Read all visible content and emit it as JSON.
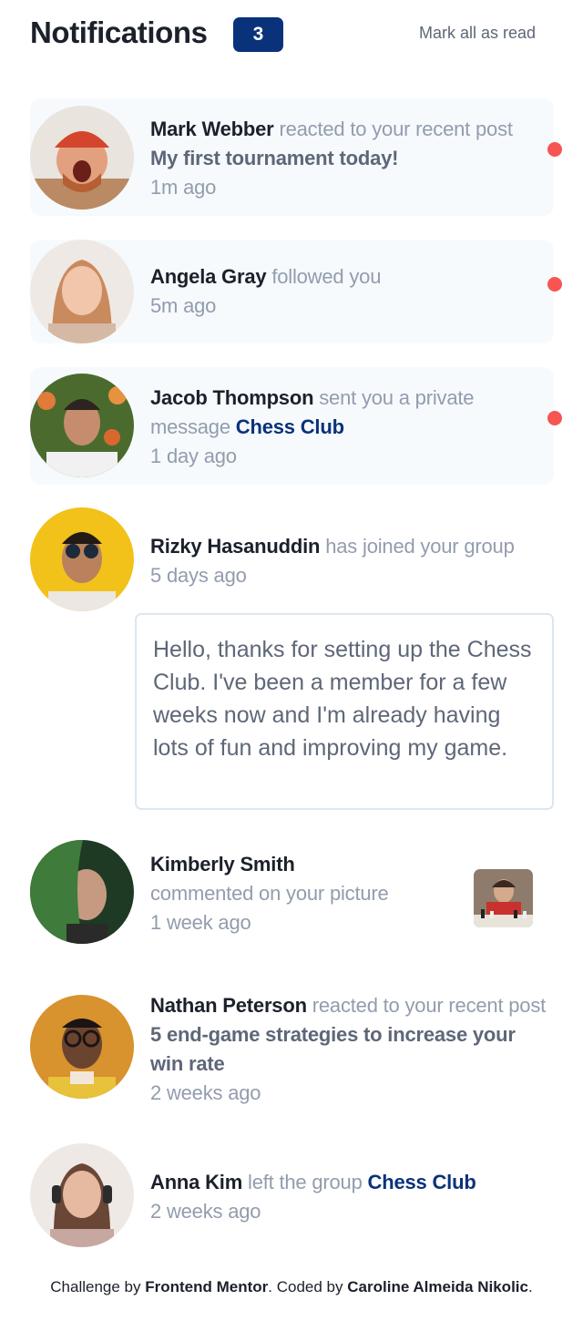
{
  "header": {
    "title": "Notifications",
    "unread_count": "3",
    "mark_all_label": "Mark all as read"
  },
  "colors": {
    "accent": "#0a327b",
    "unread_dot": "#f65552",
    "unread_bg": "#f6fafd",
    "muted_text": "#939cad",
    "dark_text": "#1c202b"
  },
  "notifications": [
    {
      "name": "Mark Webber",
      "action": "reacted to your recent post",
      "post": "My first tournament today!",
      "time": "1m ago",
      "unread": true
    },
    {
      "name": "Angela Gray",
      "action": "followed you",
      "time": "5m ago",
      "unread": true
    },
    {
      "name": "Jacob Thompson",
      "action": "sent you a private message",
      "group": "Chess Club",
      "time": "1 day ago",
      "unread": true
    },
    {
      "name": "Rizky Hasanuddin",
      "action": "has joined your group",
      "time": "5 days ago",
      "unread": false,
      "message": "Hello, thanks for setting up the Chess Club. I've been a member for a few weeks now and I'm already having lots of fun and improving my game."
    },
    {
      "name": "Kimberly Smith",
      "action": "commented on your picture",
      "time": "1 week ago",
      "unread": false,
      "picture": "chess-picture-thumbnail"
    },
    {
      "name": "Nathan Peterson",
      "action": "reacted to your recent post",
      "post": "5 end-game strategies to increase your win rate",
      "time": "2 weeks ago",
      "unread": false
    },
    {
      "name": "Anna Kim",
      "action": "left the group",
      "group": "Chess Club",
      "time": "2 weeks ago",
      "unread": false
    }
  ],
  "attribution": {
    "prefix": "Challenge by",
    "mentor": "Frontend Mentor",
    "middle": ". Coded by",
    "author": "Caroline Almeida Nikolic",
    "suffix": "."
  }
}
